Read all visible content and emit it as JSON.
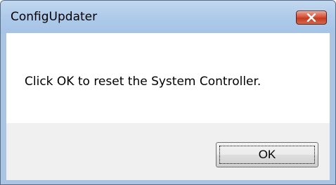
{
  "window": {
    "title": "ConfigUpdater",
    "close_icon": "close-icon"
  },
  "dialog": {
    "message": "Click OK to reset the System Controller.",
    "ok_label": "OK"
  },
  "colors": {
    "titlebar": "#b0cbea",
    "close_button": "#c23a22",
    "content_background": "#ffffff",
    "footer_background": "#f0f0f0"
  }
}
